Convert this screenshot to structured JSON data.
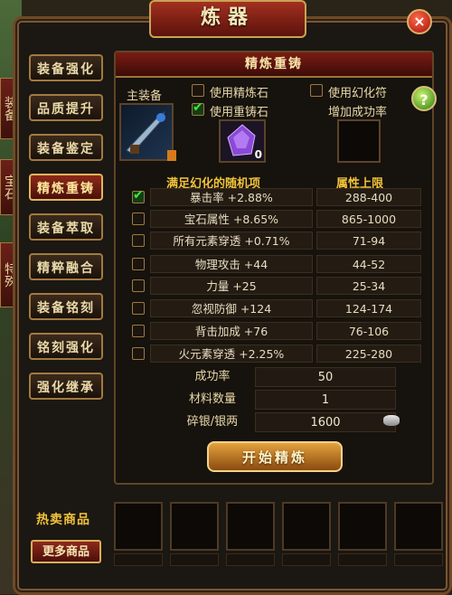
{
  "window": {
    "title": "炼器",
    "close_label": "×"
  },
  "side_partial_tabs": [
    "装",
    "备",
    "宝",
    "石",
    "特",
    "殊"
  ],
  "tabs": [
    {
      "label": "装备强化",
      "active": false
    },
    {
      "label": "品质提升",
      "active": false
    },
    {
      "label": "装备鉴定",
      "active": false
    },
    {
      "label": "精炼重铸",
      "active": true
    },
    {
      "label": "装备萃取",
      "active": false
    },
    {
      "label": "精粹融合",
      "active": false
    },
    {
      "label": "装备铭刻",
      "active": false
    },
    {
      "label": "铭刻强化",
      "active": false
    },
    {
      "label": "强化继承",
      "active": false
    }
  ],
  "panel": {
    "header": "精炼重铸",
    "main_equip_label": "主装备",
    "options": {
      "use_refine_stone": {
        "label": "使用精炼石",
        "checked": false
      },
      "use_recast_stone": {
        "label": "使用重铸石",
        "checked": true
      },
      "use_phantom_charm": {
        "label": "使用幻化符",
        "checked": false
      }
    },
    "success_boost_label": "增加成功率",
    "gem_count": "0",
    "attr_header_left": "满足幻化的随机项",
    "attr_header_right": "属性上限",
    "attributes": [
      {
        "name": "暴击率 +2.88%",
        "range": "288-400",
        "checked": true
      },
      {
        "name": "宝石属性 +8.65%",
        "range": "865-1000",
        "checked": false
      },
      {
        "name": "所有元素穿透 +0.71%",
        "range": "71-94",
        "checked": false
      },
      {
        "name": "物理攻击 +44",
        "range": "44-52",
        "checked": false
      },
      {
        "name": "力量 +25",
        "range": "25-34",
        "checked": false
      },
      {
        "name": "忽视防御 +124",
        "range": "124-174",
        "checked": false
      },
      {
        "name": "背击加成 +76",
        "range": "76-106",
        "checked": false
      },
      {
        "name": "火元素穿透 +2.25%",
        "range": "225-280",
        "checked": false
      }
    ],
    "success_rate_label": "成功率",
    "success_rate_value": "50",
    "material_count_label": "材料数量",
    "material_count_value": "1",
    "cost_label": "碎银/银两",
    "cost_value": "1600",
    "start_button": "开始精炼"
  },
  "shop": {
    "hot_label": "热卖商品",
    "more_button": "更多商品",
    "slot_count": 6
  },
  "colors": {
    "accent_gold": "#f0c23b",
    "frame_brown": "#6f4a26",
    "active_red": "#8d2a1a",
    "check_green": "#3fe83a"
  }
}
